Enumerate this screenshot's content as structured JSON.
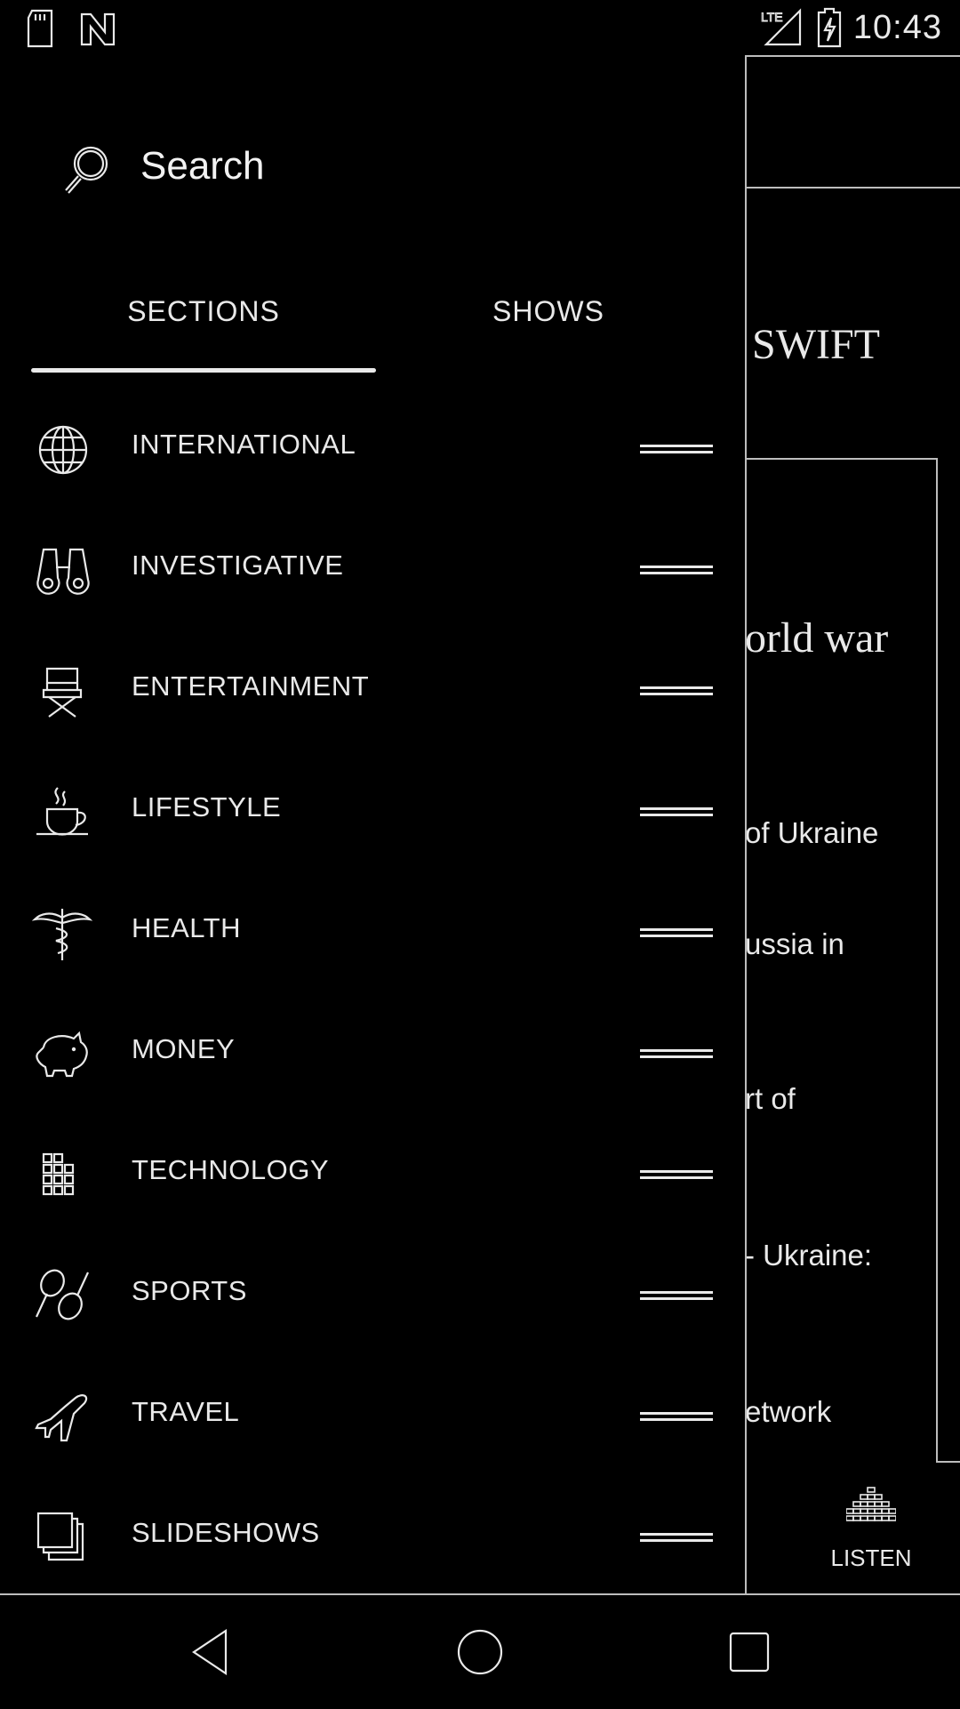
{
  "status_bar": {
    "time": "10:43",
    "left_icons": [
      "sd-card-icon",
      "nfc-icon"
    ],
    "right_icons": [
      "lte-signal-icon",
      "battery-charging-icon"
    ]
  },
  "search": {
    "label": "Search"
  },
  "tabs": [
    {
      "label": "SECTIONS",
      "selected": true
    },
    {
      "label": "SHOWS",
      "selected": false
    }
  ],
  "sections": [
    {
      "label": "INTERNATIONAL",
      "icon": "globe-icon"
    },
    {
      "label": "INVESTIGATIVE",
      "icon": "binoculars-icon"
    },
    {
      "label": "ENTERTAINMENT",
      "icon": "director-chair-icon"
    },
    {
      "label": "LIFESTYLE",
      "icon": "coffee-cup-icon"
    },
    {
      "label": "HEALTH",
      "icon": "caduceus-icon"
    },
    {
      "label": "MONEY",
      "icon": "piggy-bank-icon"
    },
    {
      "label": "TECHNOLOGY",
      "icon": "grid-blocks-icon"
    },
    {
      "label": "SPORTS",
      "icon": "tennis-rackets-icon"
    },
    {
      "label": "TRAVEL",
      "icon": "airplane-icon"
    },
    {
      "label": "SLIDESHOWS",
      "icon": "stacked-photos-icon"
    }
  ],
  "background": {
    "header_text": "SWIFT",
    "headline_fragment": "orld war",
    "snippets": [
      "of Ukraine",
      "ussia in",
      "rt of",
      "- Ukraine:",
      "etwork"
    ],
    "listen_label": "LISTEN"
  },
  "nav_bar": {
    "icons": [
      "back-icon",
      "home-icon",
      "recents-icon"
    ]
  }
}
